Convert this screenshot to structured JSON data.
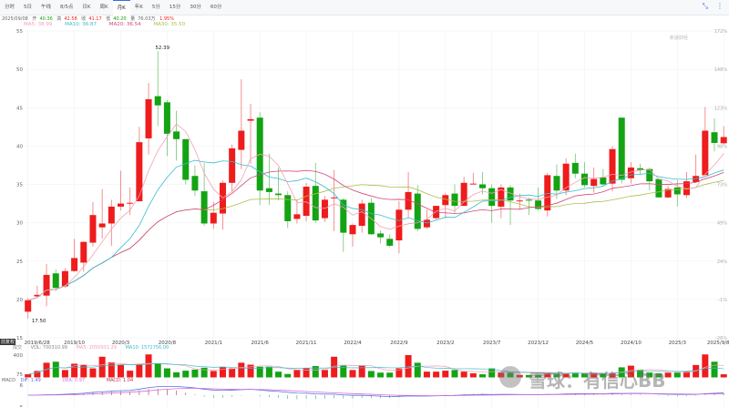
{
  "tabs": [
    "分时",
    "5日",
    "午线",
    "8/5点",
    "日K",
    "周K",
    "月K",
    "年K",
    "5分",
    "15分",
    "30分",
    "60分"
  ],
  "active_tab": "月K",
  "info": {
    "date": "2025/09/08",
    "open_label": "开",
    "open": "40.36",
    "high_label": "高",
    "high": "42.58",
    "close_label": "收",
    "close": "41.17",
    "low_label": "低",
    "low": "40.20",
    "vol_label": "量",
    "vol": "76.03万",
    "change": "1.95%"
  },
  "ma_legend": {
    "ma5": "MA5: 38.99",
    "ma10": "MA10: 36.87",
    "ma20": "MA20: 36.54",
    "ma30": "MA30: 35.50"
  },
  "vol_legend": {
    "adj": "前复权",
    "label": "成交",
    "vol": "VOL: 700310.99",
    "ma5": "MA5: 2050931.29",
    "ma10": "MA10: 1572756.00"
  },
  "macd_legend": {
    "label": "MACD",
    "dif": "DIF: 1.49",
    "dea": "DEA: 0.97",
    "macd": "MACD: 1.04"
  },
  "watermark": "雪球：有信心BB",
  "sina_logo": "新浪财经",
  "colors": {
    "up": "#ee1c1c",
    "down": "#13a313",
    "ma5": "#f2a0b4",
    "ma10": "#39bccd",
    "ma20": "#d2467a",
    "ma30": "#a9c048",
    "dif": "#5a6fe0",
    "dea": "#d070d8"
  },
  "chart_data": {
    "type": "candlestick",
    "ylim": [
      15,
      55
    ],
    "y_ticks": [
      "55",
      "50",
      "45",
      "40",
      "35",
      "30",
      "25",
      "20",
      "15"
    ],
    "y_ticks_right": [
      "172%",
      "148%",
      "123%",
      "98%",
      "73%",
      "49%",
      "24%",
      "-1%",
      "-26%"
    ],
    "x_labels": [
      "2019/6/28",
      "2019/10",
      "2020/3",
      "2020/8",
      "2021/1",
      "2021/6",
      "2021/11",
      "2022/4",
      "2022/9",
      "2023/2",
      "2023/7",
      "2023/12",
      "2024/5",
      "2024/10",
      "2025/3",
      "2025/9/8"
    ],
    "max_label": "52.39",
    "min_label": "17.50",
    "vol_ticks": [
      "400",
      "75"
    ],
    "macd_ticks": [
      "6",
      "-6"
    ],
    "ohlc": [
      [
        18.4,
        20.2,
        17.5,
        19.9
      ],
      [
        20.4,
        21.8,
        20.3,
        20.6
      ],
      [
        20.5,
        24.6,
        19.1,
        23.2
      ],
      [
        23.4,
        23.9,
        21.1,
        21.5
      ],
      [
        21.7,
        24.1,
        21.5,
        23.7
      ],
      [
        23.7,
        27.9,
        23.6,
        25.4
      ],
      [
        24.8,
        27.6,
        23.6,
        27.5
      ],
      [
        27.4,
        32.7,
        26.9,
        31.0
      ],
      [
        29.4,
        34.4,
        27.9,
        29.9
      ],
      [
        29.9,
        33.0,
        27.0,
        32.1
      ],
      [
        32.1,
        36.8,
        31.6,
        32.5
      ],
      [
        32.6,
        34.6,
        31.0,
        32.6
      ],
      [
        32.8,
        42.5,
        32.8,
        40.5
      ],
      [
        41.0,
        48.2,
        38.9,
        46.1
      ],
      [
        46.5,
        52.39,
        42.6,
        45.3
      ],
      [
        45.7,
        46.0,
        38.7,
        41.6
      ],
      [
        41.9,
        44.6,
        38.1,
        40.9
      ],
      [
        40.9,
        40.9,
        35.0,
        35.6
      ],
      [
        36.1,
        37.5,
        33.5,
        34.2
      ],
      [
        34.1,
        37.8,
        29.6,
        29.9
      ],
      [
        29.9,
        32.7,
        29.2,
        31.3
      ],
      [
        31.2,
        35.5,
        29.1,
        35.2
      ],
      [
        35.2,
        40.2,
        34.1,
        39.7
      ],
      [
        39.5,
        48.7,
        37.0,
        42.0
      ],
      [
        43.3,
        45.5,
        37.7,
        43.5
      ],
      [
        43.7,
        44.4,
        32.3,
        34.2
      ],
      [
        34.5,
        39.0,
        32.3,
        34.0
      ],
      [
        33.8,
        37.2,
        32.9,
        33.6
      ],
      [
        33.6,
        34.1,
        29.3,
        30.2
      ],
      [
        30.5,
        32.9,
        29.9,
        31.1
      ],
      [
        30.9,
        35.2,
        30.2,
        34.7
      ],
      [
        34.8,
        37.8,
        30.0,
        30.3
      ],
      [
        30.6,
        33.5,
        30.1,
        33.0
      ],
      [
        33.2,
        36.9,
        28.9,
        33.3
      ],
      [
        33.0,
        33.2,
        26.2,
        28.7
      ],
      [
        28.5,
        29.9,
        26.9,
        29.7
      ],
      [
        29.6,
        33.0,
        28.7,
        32.5
      ],
      [
        32.6,
        33.2,
        28.4,
        28.5
      ],
      [
        28.6,
        29.0,
        27.3,
        28.1
      ],
      [
        27.9,
        28.5,
        26.8,
        27.0
      ],
      [
        27.7,
        32.8,
        26.0,
        31.7
      ],
      [
        31.7,
        36.6,
        30.6,
        34.0
      ],
      [
        33.8,
        34.9,
        28.9,
        29.2
      ],
      [
        29.4,
        31.7,
        29.2,
        30.4
      ],
      [
        30.6,
        32.2,
        30.4,
        32.2
      ],
      [
        32.3,
        33.9,
        30.6,
        33.6
      ],
      [
        33.8,
        35.0,
        31.2,
        32.2
      ],
      [
        32.2,
        36.0,
        32.2,
        35.2
      ],
      [
        35.0,
        36.5,
        35.0,
        35.1
      ],
      [
        35.0,
        36.6,
        33.7,
        34.5
      ],
      [
        34.5,
        35.0,
        30.0,
        32.2
      ],
      [
        32.1,
        35.0,
        30.6,
        34.6
      ],
      [
        34.6,
        34.9,
        29.7,
        32.9
      ],
      [
        32.9,
        33.8,
        31.7,
        32.9
      ],
      [
        33.0,
        33.3,
        31.0,
        32.9
      ],
      [
        32.9,
        34.6,
        31.6,
        31.8
      ],
      [
        31.6,
        36.5,
        30.8,
        36.2
      ],
      [
        36.1,
        37.6,
        33.1,
        34.2
      ],
      [
        34.2,
        38.4,
        33.6,
        37.7
      ],
      [
        37.8,
        39.0,
        35.8,
        36.4
      ],
      [
        36.4,
        37.9,
        34.6,
        34.9
      ],
      [
        34.8,
        37.2,
        33.9,
        35.7
      ],
      [
        35.9,
        37.0,
        34.7,
        35.0
      ],
      [
        35.1,
        40.0,
        34.1,
        39.6
      ],
      [
        43.7,
        43.7,
        35.1,
        35.6
      ],
      [
        35.8,
        37.9,
        35.1,
        37.2
      ],
      [
        37.1,
        37.7,
        36.2,
        36.9
      ],
      [
        37.0,
        37.2,
        34.2,
        35.4
      ],
      [
        35.7,
        35.8,
        33.3,
        33.3
      ],
      [
        33.3,
        34.8,
        33.2,
        34.4
      ],
      [
        34.6,
        35.6,
        32.1,
        33.7
      ],
      [
        33.6,
        36.6,
        33.2,
        35.4
      ],
      [
        35.3,
        38.9,
        35.2,
        36.1
      ],
      [
        36.2,
        45.1,
        36.2,
        42.0
      ],
      [
        41.8,
        43.6,
        39.3,
        40.4
      ],
      [
        40.36,
        42.58,
        40.2,
        41.17
      ]
    ],
    "volume_wan": [
      86,
      140,
      275,
      292,
      156,
      259,
      238,
      183,
      373,
      281,
      238,
      145,
      248,
      411,
      265,
      183,
      118,
      145,
      162,
      194,
      140,
      200,
      183,
      275,
      243,
      210,
      210,
      129,
      91,
      156,
      183,
      221,
      156,
      373,
      238,
      156,
      232,
      140,
      113,
      113,
      183,
      400,
      275,
      129,
      129,
      145,
      156,
      129,
      102,
      86,
      183,
      113,
      113,
      75,
      75,
      75,
      113,
      113,
      102,
      113,
      102,
      113,
      102,
      102,
      200,
      227,
      156,
      113,
      102,
      113,
      113,
      129,
      238,
      411,
      292,
      86
    ]
  }
}
